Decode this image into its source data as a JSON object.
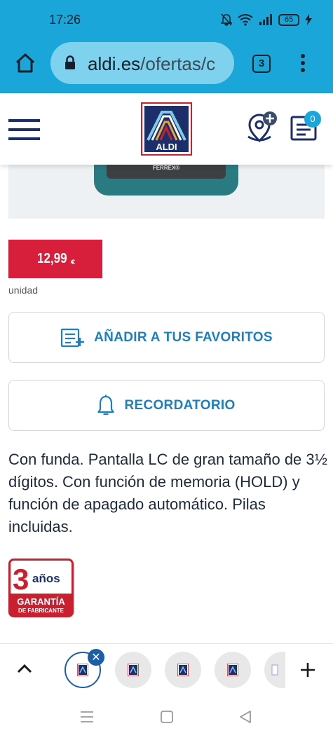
{
  "status": {
    "time": "17:26",
    "battery": "65"
  },
  "browser": {
    "url_domain": "aldi.es",
    "url_path": "/ofertas/c",
    "tab_count": "3"
  },
  "header": {
    "logo_text": "ALDI",
    "cart_count": "0"
  },
  "product": {
    "image_brand": "FERREX®",
    "price": "12,99",
    "currency": "€",
    "unit": "unidad",
    "favorites_label": "AÑADIR A TUS FAVORITOS",
    "reminder_label": "RECORDATORIO",
    "description": "Con funda. Pantalla LC de gran tamaño de 3½ dígitos. Con función de memoria (HOLD) y función de apagado automático. Pilas incluidas.",
    "warranty_years": "3",
    "warranty_unit": "años",
    "warranty_line1": "GARANTÍA",
    "warranty_line2": "DE FABRICANTE"
  },
  "colors": {
    "chrome": "#1aa6d8",
    "price_bg": "#d71f3b",
    "link_blue": "#1c7fc0",
    "aldi_navy": "#1c2f6b"
  }
}
